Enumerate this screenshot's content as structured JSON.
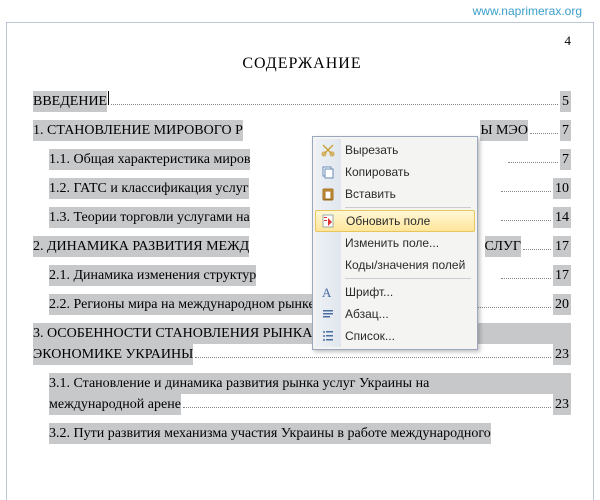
{
  "watermark": "www.naprimerax.org",
  "page_number": "4",
  "title": "СОДЕРЖАНИЕ",
  "toc": [
    {
      "text": "ВВЕДЕНИЕ",
      "page": "5",
      "sub": false,
      "cursor": true
    },
    {
      "text": "1. СТАНОВЛЕНИЕ МИРОВОГО Р",
      "tail": "Ы МЭО",
      "page": "7",
      "sub": false
    },
    {
      "text": "1.1. Общая характеристика миров",
      "page": "7",
      "sub": true
    },
    {
      "text": "1.2. ГАТС и классификация услуг",
      "page": "10",
      "sub": true
    },
    {
      "text": "1.3. Теории торговли услугами на",
      "page": "14",
      "sub": true
    },
    {
      "text": "2. ДИНАМИКА РАЗВИТИЯ МЕЖД",
      "tail": "СЛУГ",
      "page": "17",
      "sub": false
    },
    {
      "text": "2.1. Динамика изменения структур",
      "page": "17",
      "sub": true
    },
    {
      "text": "2.2. Регионы мира на международном рынке услуг",
      "page": "20",
      "sub": true
    }
  ],
  "toc_block3": {
    "line1": "3. ОСОБЕННОСТИ СТАНОВЛЕНИЯ РЫНКА УСЛУГ ВО ВНЕШНЕЙ",
    "line2": "ЭКОНОМИКЕ УКРАИНЫ",
    "page": "23"
  },
  "toc31": {
    "line1": "3.1. Становление и динамика развития рынка услуг Украины на",
    "line2": "международной арене",
    "page": "23"
  },
  "toc32": "3.2. Пути развития механизма участия Украины в работе международного",
  "context_menu": {
    "cut": "Вырезать",
    "copy": "Копировать",
    "paste": "Вставить",
    "update_field": "Обновить поле",
    "edit_field": "Изменить поле...",
    "field_codes": "Коды/значения полей",
    "font": "Шрифт...",
    "paragraph": "Абзац...",
    "list": "Список..."
  }
}
